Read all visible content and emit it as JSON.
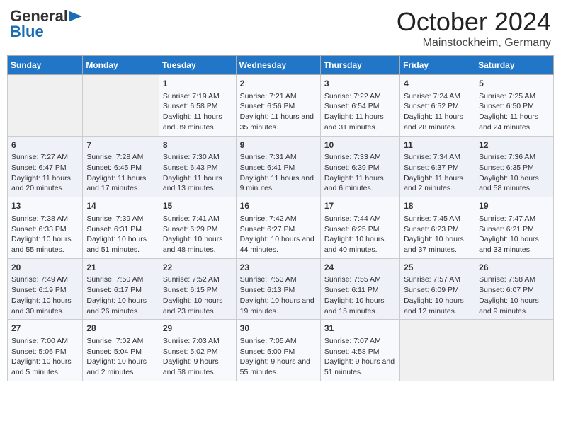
{
  "header": {
    "logo_general": "General",
    "logo_blue": "Blue",
    "month_title": "October 2024",
    "location": "Mainstockheim, Germany"
  },
  "days_of_week": [
    "Sunday",
    "Monday",
    "Tuesday",
    "Wednesday",
    "Thursday",
    "Friday",
    "Saturday"
  ],
  "weeks": [
    [
      {
        "day": "",
        "sunrise": "",
        "sunset": "",
        "daylight": "",
        "empty": true
      },
      {
        "day": "",
        "sunrise": "",
        "sunset": "",
        "daylight": "",
        "empty": true
      },
      {
        "day": "1",
        "sunrise": "Sunrise: 7:19 AM",
        "sunset": "Sunset: 6:58 PM",
        "daylight": "Daylight: 11 hours and 39 minutes."
      },
      {
        "day": "2",
        "sunrise": "Sunrise: 7:21 AM",
        "sunset": "Sunset: 6:56 PM",
        "daylight": "Daylight: 11 hours and 35 minutes."
      },
      {
        "day": "3",
        "sunrise": "Sunrise: 7:22 AM",
        "sunset": "Sunset: 6:54 PM",
        "daylight": "Daylight: 11 hours and 31 minutes."
      },
      {
        "day": "4",
        "sunrise": "Sunrise: 7:24 AM",
        "sunset": "Sunset: 6:52 PM",
        "daylight": "Daylight: 11 hours and 28 minutes."
      },
      {
        "day": "5",
        "sunrise": "Sunrise: 7:25 AM",
        "sunset": "Sunset: 6:50 PM",
        "daylight": "Daylight: 11 hours and 24 minutes."
      }
    ],
    [
      {
        "day": "6",
        "sunrise": "Sunrise: 7:27 AM",
        "sunset": "Sunset: 6:47 PM",
        "daylight": "Daylight: 11 hours and 20 minutes."
      },
      {
        "day": "7",
        "sunrise": "Sunrise: 7:28 AM",
        "sunset": "Sunset: 6:45 PM",
        "daylight": "Daylight: 11 hours and 17 minutes."
      },
      {
        "day": "8",
        "sunrise": "Sunrise: 7:30 AM",
        "sunset": "Sunset: 6:43 PM",
        "daylight": "Daylight: 11 hours and 13 minutes."
      },
      {
        "day": "9",
        "sunrise": "Sunrise: 7:31 AM",
        "sunset": "Sunset: 6:41 PM",
        "daylight": "Daylight: 11 hours and 9 minutes."
      },
      {
        "day": "10",
        "sunrise": "Sunrise: 7:33 AM",
        "sunset": "Sunset: 6:39 PM",
        "daylight": "Daylight: 11 hours and 6 minutes."
      },
      {
        "day": "11",
        "sunrise": "Sunrise: 7:34 AM",
        "sunset": "Sunset: 6:37 PM",
        "daylight": "Daylight: 11 hours and 2 minutes."
      },
      {
        "day": "12",
        "sunrise": "Sunrise: 7:36 AM",
        "sunset": "Sunset: 6:35 PM",
        "daylight": "Daylight: 10 hours and 58 minutes."
      }
    ],
    [
      {
        "day": "13",
        "sunrise": "Sunrise: 7:38 AM",
        "sunset": "Sunset: 6:33 PM",
        "daylight": "Daylight: 10 hours and 55 minutes."
      },
      {
        "day": "14",
        "sunrise": "Sunrise: 7:39 AM",
        "sunset": "Sunset: 6:31 PM",
        "daylight": "Daylight: 10 hours and 51 minutes."
      },
      {
        "day": "15",
        "sunrise": "Sunrise: 7:41 AM",
        "sunset": "Sunset: 6:29 PM",
        "daylight": "Daylight: 10 hours and 48 minutes."
      },
      {
        "day": "16",
        "sunrise": "Sunrise: 7:42 AM",
        "sunset": "Sunset: 6:27 PM",
        "daylight": "Daylight: 10 hours and 44 minutes."
      },
      {
        "day": "17",
        "sunrise": "Sunrise: 7:44 AM",
        "sunset": "Sunset: 6:25 PM",
        "daylight": "Daylight: 10 hours and 40 minutes."
      },
      {
        "day": "18",
        "sunrise": "Sunrise: 7:45 AM",
        "sunset": "Sunset: 6:23 PM",
        "daylight": "Daylight: 10 hours and 37 minutes."
      },
      {
        "day": "19",
        "sunrise": "Sunrise: 7:47 AM",
        "sunset": "Sunset: 6:21 PM",
        "daylight": "Daylight: 10 hours and 33 minutes."
      }
    ],
    [
      {
        "day": "20",
        "sunrise": "Sunrise: 7:49 AM",
        "sunset": "Sunset: 6:19 PM",
        "daylight": "Daylight: 10 hours and 30 minutes."
      },
      {
        "day": "21",
        "sunrise": "Sunrise: 7:50 AM",
        "sunset": "Sunset: 6:17 PM",
        "daylight": "Daylight: 10 hours and 26 minutes."
      },
      {
        "day": "22",
        "sunrise": "Sunrise: 7:52 AM",
        "sunset": "Sunset: 6:15 PM",
        "daylight": "Daylight: 10 hours and 23 minutes."
      },
      {
        "day": "23",
        "sunrise": "Sunrise: 7:53 AM",
        "sunset": "Sunset: 6:13 PM",
        "daylight": "Daylight: 10 hours and 19 minutes."
      },
      {
        "day": "24",
        "sunrise": "Sunrise: 7:55 AM",
        "sunset": "Sunset: 6:11 PM",
        "daylight": "Daylight: 10 hours and 15 minutes."
      },
      {
        "day": "25",
        "sunrise": "Sunrise: 7:57 AM",
        "sunset": "Sunset: 6:09 PM",
        "daylight": "Daylight: 10 hours and 12 minutes."
      },
      {
        "day": "26",
        "sunrise": "Sunrise: 7:58 AM",
        "sunset": "Sunset: 6:07 PM",
        "daylight": "Daylight: 10 hours and 9 minutes."
      }
    ],
    [
      {
        "day": "27",
        "sunrise": "Sunrise: 7:00 AM",
        "sunset": "Sunset: 5:06 PM",
        "daylight": "Daylight: 10 hours and 5 minutes."
      },
      {
        "day": "28",
        "sunrise": "Sunrise: 7:02 AM",
        "sunset": "Sunset: 5:04 PM",
        "daylight": "Daylight: 10 hours and 2 minutes."
      },
      {
        "day": "29",
        "sunrise": "Sunrise: 7:03 AM",
        "sunset": "Sunset: 5:02 PM",
        "daylight": "Daylight: 9 hours and 58 minutes."
      },
      {
        "day": "30",
        "sunrise": "Sunrise: 7:05 AM",
        "sunset": "Sunset: 5:00 PM",
        "daylight": "Daylight: 9 hours and 55 minutes."
      },
      {
        "day": "31",
        "sunrise": "Sunrise: 7:07 AM",
        "sunset": "Sunset: 4:58 PM",
        "daylight": "Daylight: 9 hours and 51 minutes."
      },
      {
        "day": "",
        "sunrise": "",
        "sunset": "",
        "daylight": "",
        "empty": true
      },
      {
        "day": "",
        "sunrise": "",
        "sunset": "",
        "daylight": "",
        "empty": true
      }
    ]
  ]
}
